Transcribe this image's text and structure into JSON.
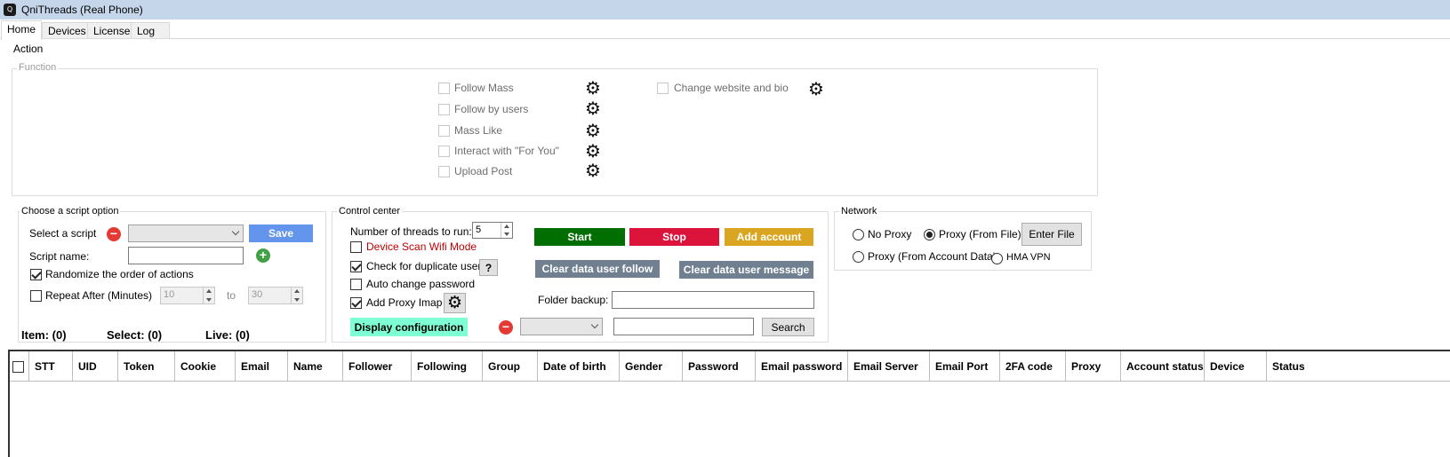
{
  "window": {
    "title": "QniThreads (Real Phone)",
    "icon": "app-icon"
  },
  "tabs": [
    "Home",
    "Devices",
    "License",
    "Log"
  ],
  "action": {
    "label": "Action",
    "function": {
      "label": "Function",
      "items": [
        "Follow Mass",
        "Follow by users",
        "Mass Like",
        "Interact with \"For You\"",
        "Upload Post"
      ],
      "extra_item": "Change website and bio"
    }
  },
  "script_option": {
    "title": "Choose a script option",
    "select_label": "Select a script",
    "save_label": "Save",
    "name_label": "Script name:",
    "name_value": "",
    "randomize_label": "Randomize the order of actions",
    "repeat_label": "Repeat After (Minutes)",
    "repeat_from": "10",
    "to_label": "to",
    "repeat_to": "30"
  },
  "stats": {
    "item": "Item: (0)",
    "select": "Select: (0)",
    "live": "Live: (0)"
  },
  "control": {
    "title": "Control center",
    "threads_label": "Number of threads to run:",
    "threads_value": "5",
    "device_scan_label": "Device Scan Wifi Mode",
    "check_dup_label": "Check for duplicate users",
    "help_label": "?",
    "auto_change_label": "Auto change password",
    "add_proxy_label": "Add Proxy Imap",
    "display_config_label": "Display configuration",
    "start_label": "Start",
    "stop_label": "Stop",
    "add_account_label": "Add account",
    "clear_follow_label": "Clear data user follow",
    "clear_message_label": "Clear data user message",
    "folder_label": "Folder backup:",
    "folder_value": "",
    "search_value": "",
    "search_label": "Search"
  },
  "network": {
    "title": "Network",
    "no_proxy": "No Proxy",
    "proxy_file": "Proxy (From File)",
    "proxy_account": "Proxy (From Account Data)",
    "hma": "HMA VPN",
    "enter_file": "Enter File"
  },
  "table": {
    "columns": [
      "STT",
      "UID",
      "Token",
      "Cookie",
      "Email",
      "Name",
      "Follower",
      "Following",
      "Group",
      "Date of birth",
      "Gender",
      "Password",
      "Email password",
      "Email Server",
      "Email Port",
      "2FA code",
      "Proxy",
      "Account status",
      "Device",
      "Status"
    ]
  },
  "colors": {
    "start": "#006e00",
    "stop": "#dc143c",
    "add_account": "#daa520",
    "save": "#6495ed",
    "clear": "#708090",
    "display_config": "#7fffd4",
    "remove": "#e53935",
    "add": "#43a047",
    "titlebar": "#c5d6ea"
  }
}
